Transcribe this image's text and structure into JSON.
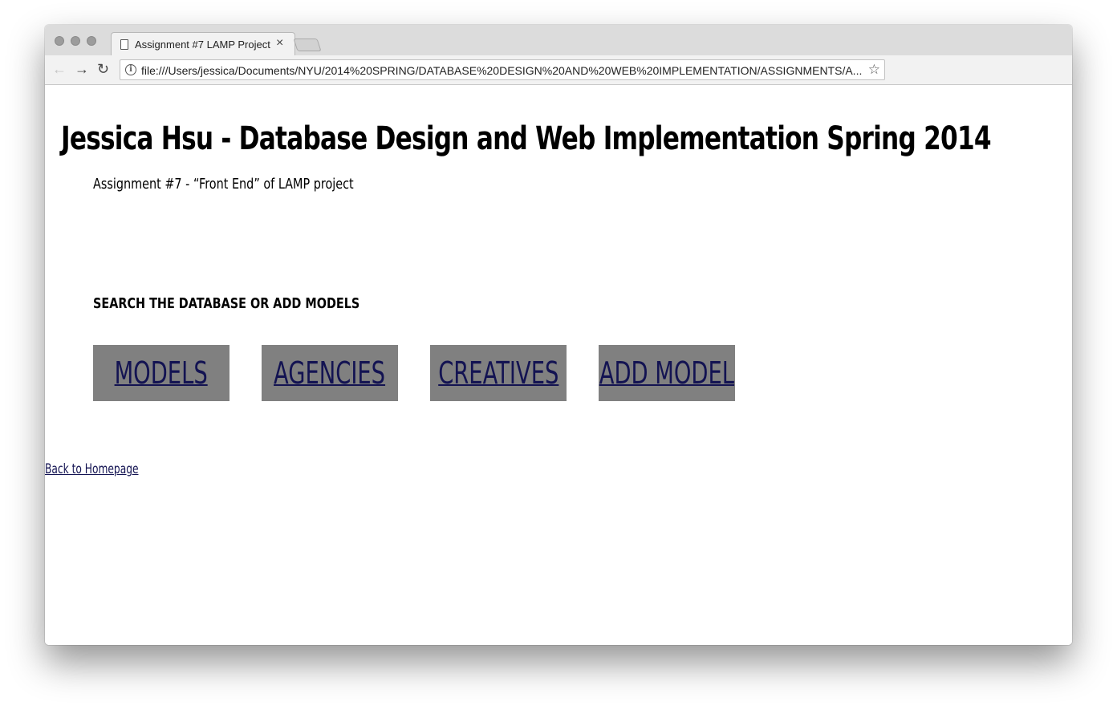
{
  "browser": {
    "tab_title": "Assignment #7 LAMP Project",
    "tab_close": "×",
    "url": "file:///Users/jessica/Documents/NYU/2014%20SPRING/DATABASE%20DESIGN%20AND%20WEB%20IMPLEMENTATION/ASSIGNMENTS/A...",
    "icons": [
      "close-window-icon",
      "minimize-window-icon",
      "maximize-window-icon",
      "document-icon",
      "back-icon",
      "forward-icon",
      "reload-icon",
      "info-icon",
      "star-icon"
    ]
  },
  "page": {
    "title": "Jessica Hsu - Database Design and Web Implementation Spring 2014",
    "subtitle": "Assignment #7 - “Front End” of LAMP project",
    "section_heading": "SEARCH THE DATABASE OR ADD MODELS",
    "buttons": [
      {
        "label": "MODELS"
      },
      {
        "label": "AGENCIES"
      },
      {
        "label": "CREATIVES"
      },
      {
        "label": "ADD MODEL"
      }
    ],
    "back_link": "Back to Homepage"
  },
  "colors": {
    "button_bg": "#808080",
    "link": "#131352",
    "tabstrip": "#dcdcdc",
    "toolbar": "#f2f2f2"
  }
}
